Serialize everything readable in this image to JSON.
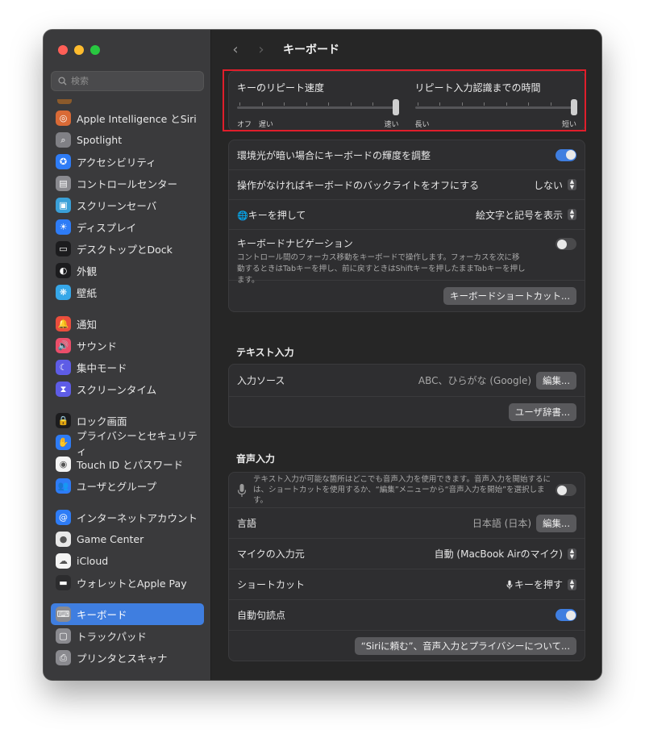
{
  "search": {
    "placeholder": "検索"
  },
  "sidebar": {
    "items": [
      {
        "label": "Apple Intelligence とSiri",
        "icon": "apple-intelligence-icon",
        "glyph": "◎",
        "color": "#d96a36"
      },
      {
        "label": "Spotlight",
        "icon": "spotlight-icon",
        "glyph": "⌕",
        "color": "#808085"
      },
      {
        "label": "アクセシビリティ",
        "icon": "accessibility-icon",
        "glyph": "✪",
        "color": "#2e7cf6"
      },
      {
        "label": "コントロールセンター",
        "icon": "control-center-icon",
        "glyph": "▤",
        "color": "#8a8a8f"
      },
      {
        "label": "スクリーンセーバ",
        "icon": "screensaver-icon",
        "glyph": "▣",
        "color": "#3aa0d8"
      },
      {
        "label": "ディスプレイ",
        "icon": "display-icon",
        "glyph": "☀",
        "color": "#2e7cf6"
      },
      {
        "label": "デスクトップとDock",
        "icon": "desktop-dock-icon",
        "glyph": "▭",
        "color": "#1c1c1e"
      },
      {
        "label": "外観",
        "icon": "appearance-icon",
        "glyph": "◐",
        "color": "#1c1c1e"
      },
      {
        "label": "壁紙",
        "icon": "wallpaper-icon",
        "glyph": "❋",
        "color": "#36a7e8"
      },
      {
        "label": "通知",
        "icon": "notifications-icon",
        "glyph": "🔔",
        "color": "#eb4e3d"
      },
      {
        "label": "サウンド",
        "icon": "sound-icon",
        "glyph": "🔊",
        "color": "#eb4e6a"
      },
      {
        "label": "集中モード",
        "icon": "focus-icon",
        "glyph": "☾",
        "color": "#5e5ce6"
      },
      {
        "label": "スクリーンタイム",
        "icon": "screen-time-icon",
        "glyph": "⧗",
        "color": "#5e5ce6"
      },
      {
        "label": "ロック画面",
        "icon": "lock-screen-icon",
        "glyph": "🔒",
        "color": "#1c1c1e"
      },
      {
        "label": "プライバシーとセキュリティ",
        "icon": "privacy-hand-icon",
        "glyph": "✋",
        "color": "#2e7cf6"
      },
      {
        "label": "Touch ID とパスワード",
        "icon": "touch-id-icon",
        "glyph": "◉",
        "color": "#f4f4f4"
      },
      {
        "label": "ユーザとグループ",
        "icon": "users-groups-icon",
        "glyph": "👥",
        "color": "#2e7cf6"
      },
      {
        "label": "インターネットアカウント",
        "icon": "internet-accounts-icon",
        "glyph": "@",
        "color": "#2e7cf6"
      },
      {
        "label": "Game Center",
        "icon": "game-center-icon",
        "glyph": "●",
        "color": "#e8e8e8"
      },
      {
        "label": "iCloud",
        "icon": "icloud-icon",
        "glyph": "☁",
        "color": "#f4f4f4"
      },
      {
        "label": "ウォレットとApple Pay",
        "icon": "wallet-icon",
        "glyph": "▬",
        "color": "#2c2c2e"
      },
      {
        "label": "キーボード",
        "icon": "keyboard-icon",
        "glyph": "⌨",
        "color": "#8a8a8f"
      },
      {
        "label": "トラックパッド",
        "icon": "trackpad-icon",
        "glyph": "▢",
        "color": "#8a8a8f"
      },
      {
        "label": "プリンタとスキャナ",
        "icon": "printer-icon",
        "glyph": "⎙",
        "color": "#8a8a8f"
      }
    ],
    "active_index": 21
  },
  "header": {
    "title": "キーボード",
    "back_glyph": "‹",
    "forward_glyph": "›"
  },
  "repeat": {
    "rate_label": "キーのリピート速度",
    "rate_min1": "オフ",
    "rate_min2": "遅い",
    "rate_max": "速い",
    "rate_value": 1.0,
    "delay_label": "リピート入力認識までの時間",
    "delay_min": "長い",
    "delay_max": "短い",
    "delay_value": 1.0
  },
  "keyboard": {
    "brightness_label": "環境光が暗い場合にキーボードの輝度を調整",
    "brightness_on": true,
    "backlight_label": "操作がなければキーボードのバックライトをオフにする",
    "backlight_value": "しない",
    "globe_glyph": "🌐",
    "globe_label": "キーを押して",
    "globe_value": "絵文字と記号を表示",
    "nav_label": "キーボードナビゲーション",
    "nav_desc": "コントロール間のフォーカス移動をキーボードで操作します。フォーカスを次に移動するときはTabキーを押し、前に戻すときはShiftキーを押したままTabキーを押します。",
    "nav_on": false,
    "shortcuts_button": "キーボードショートカット..."
  },
  "text_input": {
    "section_title": "テキスト入力",
    "source_label": "入力ソース",
    "source_value": "ABC、ひらがな (Google)",
    "edit_button": "編集...",
    "dictionary_button": "ユーザ辞書..."
  },
  "dictation": {
    "section_title": "音声入力",
    "desc": "テキスト入力が可能な箇所はどこでも音声入力を使用できます。音声入力を開始するには、ショートカットを使用するか、“編集”メニューから“音声入力を開始”を選択します。",
    "enabled": false,
    "language_label": "言語",
    "language_value": "日本語 (日本)",
    "language_edit": "編集...",
    "mic_label": "マイクの入力元",
    "mic_value": "自動 (MacBook Airのマイク)",
    "shortcut_label": "ショートカット",
    "shortcut_value": "キーを押す",
    "punct_label": "自動句読点",
    "punct_on": true,
    "about_button": "“Siriに頼む”、音声入力とプライバシーについて..."
  }
}
